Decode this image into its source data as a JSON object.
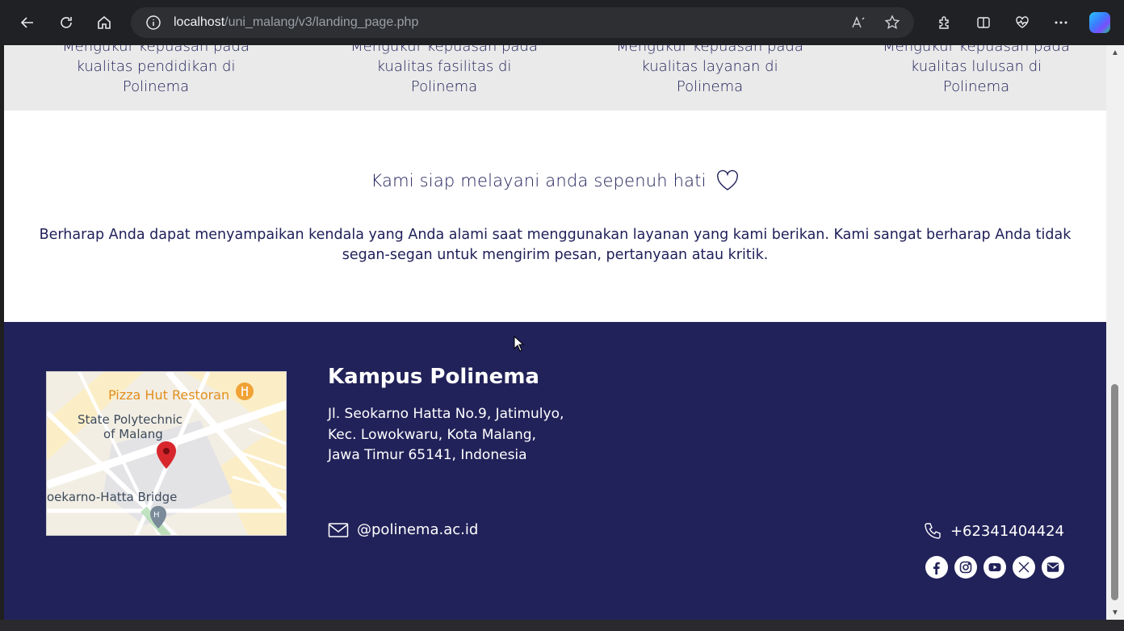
{
  "browser": {
    "url_host": "localhost",
    "url_path": "/uni_malang/v3/landing_page.php"
  },
  "features": [
    "Mengukur kepuasan pada kualitas pendidikan di Polinema",
    "Mengukur kepuasan pada kualitas fasilitas di Polinema",
    "Mengukur kepuasan pada kualitas layanan di Polinema",
    "Mengukur kepuasan pada kualitas lulusan di Polinema"
  ],
  "tagline": "Kami siap melayani anda sepenuh hati",
  "description": "Berharap Anda dapat menyampaikan kendala yang Anda alami saat menggunakan layanan yang kami berikan. Kami sangat berharap Anda tidak segan-segan untuk mengirim pesan, pertanyaan atau kritik.",
  "footer": {
    "title": "Kampus Polinema",
    "address_lines": [
      "Jl. Seokarno Hatta No.9, Jatimulyo,",
      "Kec. Lowokwaru, Kota Malang,",
      "Jawa Timur 65141, Indonesia"
    ],
    "email": "@polinema.ac.id",
    "phone": "+62341404424",
    "map_labels": {
      "restaurant": "Pizza Hut Restoran",
      "campus_line1": "State Polytechnic",
      "campus_line2": "of Malang",
      "bridge": "oekarno-Hatta Bridge"
    },
    "socials": [
      "facebook-icon",
      "instagram-icon",
      "youtube-icon",
      "x-icon",
      "mail-icon"
    ]
  },
  "colors": {
    "navy": "#22225a",
    "text_dark": "#20205a",
    "grey_band": "#eaeaea"
  }
}
